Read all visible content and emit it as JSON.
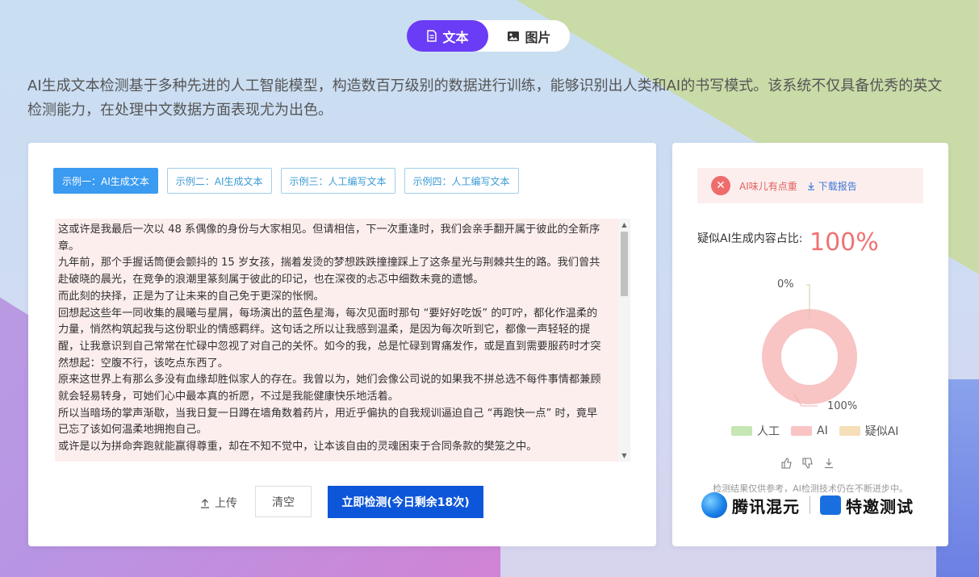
{
  "toggle": {
    "text_label": "文本",
    "image_label": "图片"
  },
  "intro": "AI生成文本检测基于多种先进的人工智能模型，构造数百万级别的数据进行训练，能够识别出人类和AI的书写模式。该系统不仅具备优秀的英文检测能力，在处理中文数据方面表现尤为出色。",
  "examples": [
    {
      "label": "示例一：AI生成文本",
      "active": true
    },
    {
      "label": "示例二：AI生成文本",
      "active": false
    },
    {
      "label": "示例三：人工编写文本",
      "active": false
    },
    {
      "label": "示例四：人工编写文本",
      "active": false
    }
  ],
  "text_paragraphs": [
    "这或许是我最后一次以 48 系偶像的身份与大家相见。但请相信，下一次重逢时，我们会亲手翻开属于彼此的全新序章。",
    "九年前，那个手握话筒便会颤抖的 15 岁女孩，揣着发烫的梦想跌跌撞撞踩上了这条星光与荆棘共生的路。我们曾共赴破晓的晨光，在竞争的浪潮里篆刻属于彼此的印记，也在深夜的忐忑中细数未竟的遗憾。",
    "而此刻的抉择，正是为了让未来的自己免于更深的怅惘。",
    "回想起这些年一同收集的晨曦与星屑，每场演出的蓝色星海，每次见面时那句 “要好好吃饭” 的叮咛，都化作温柔的力量，悄然构筑起我与这份职业的情感羁绊。这句话之所以让我感到温柔，是因为每次听到它，都像一声轻轻的提醒，让我意识到自己常常在忙碌中忽视了对自己的关怀。如今的我，总是忙碌到胃痛发作，或是直到需要服药时才突然想起：空腹不行，该吃点东西了。",
    "原来这世界上有那么多没有血缘却胜似家人的存在。我曾以为，她们会像公司说的如果我不拼总选不每件事情都兼顾就会轻易转身，可她们心中最本真的祈愿，不过是我能健康快乐地活着。",
    "所以当暗场的掌声渐歇，当我日复一日蹲在墙角数着药片，用近乎偏执的自我规训逼迫自己 “再跑快一点” 时，竟早已忘了该如何温柔地拥抱自己。",
    "或许是以为拼命奔跑就能赢得尊重，却在不知不觉中，让本该自由的灵魂困束于合同条款的樊笼之中。"
  ],
  "actions": {
    "upload": "上传",
    "clear": "清空",
    "detect": "立即检测(今日剩余18次)"
  },
  "result": {
    "alert_text": "AI味儿有点重",
    "download_label": "下载报告",
    "ratio_label": "疑似AI生成内容占比:",
    "ratio_value": "100%",
    "donut_label_zero": "0%",
    "donut_label_full": "100%",
    "legend": [
      {
        "label": "人工",
        "color": "#c6e6b4"
      },
      {
        "label": "AI",
        "color": "#f8c4c4"
      },
      {
        "label": "疑似AI",
        "color": "#f5deb8"
      }
    ],
    "disclaimer": "检测结果仅供参考，AI检测技术仍在不断进步中。",
    "brand_name": "腾讯混元",
    "brand_tag": "特邀测试"
  },
  "chart_data": {
    "type": "pie",
    "categories": [
      "人工",
      "AI",
      "疑似AI"
    ],
    "values": [
      0,
      100,
      0
    ],
    "unit": "%"
  }
}
